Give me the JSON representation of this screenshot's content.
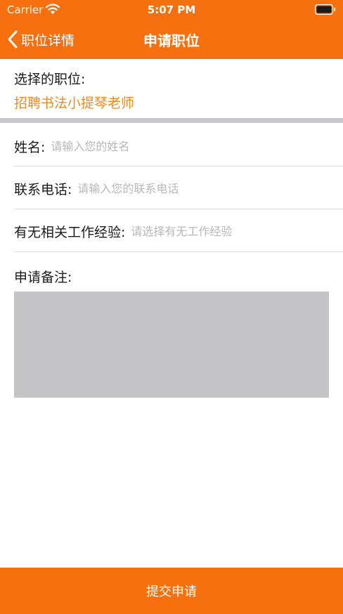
{
  "status_bar": {
    "carrier": "Carrier",
    "time": "5:07 PM"
  },
  "nav": {
    "back_label": "职位详情",
    "title": "申请职位"
  },
  "position": {
    "label": "选择的职位:",
    "value": "招聘书法小提琴老师"
  },
  "form": {
    "name": {
      "label": "姓名:",
      "placeholder": "请输入您的姓名"
    },
    "phone": {
      "label": "联系电话:",
      "placeholder": "请输入您的联系电话"
    },
    "experience": {
      "label": "有无相关工作经验:",
      "placeholder": "请选择有无工作经验"
    },
    "remark": {
      "label": "申请备注:"
    }
  },
  "submit_label": "提交申请",
  "colors": {
    "accent": "#f7700f",
    "position_text": "#f08a1f",
    "remark_bg": "#c4c4c6",
    "separator": "#c8c7cc"
  }
}
